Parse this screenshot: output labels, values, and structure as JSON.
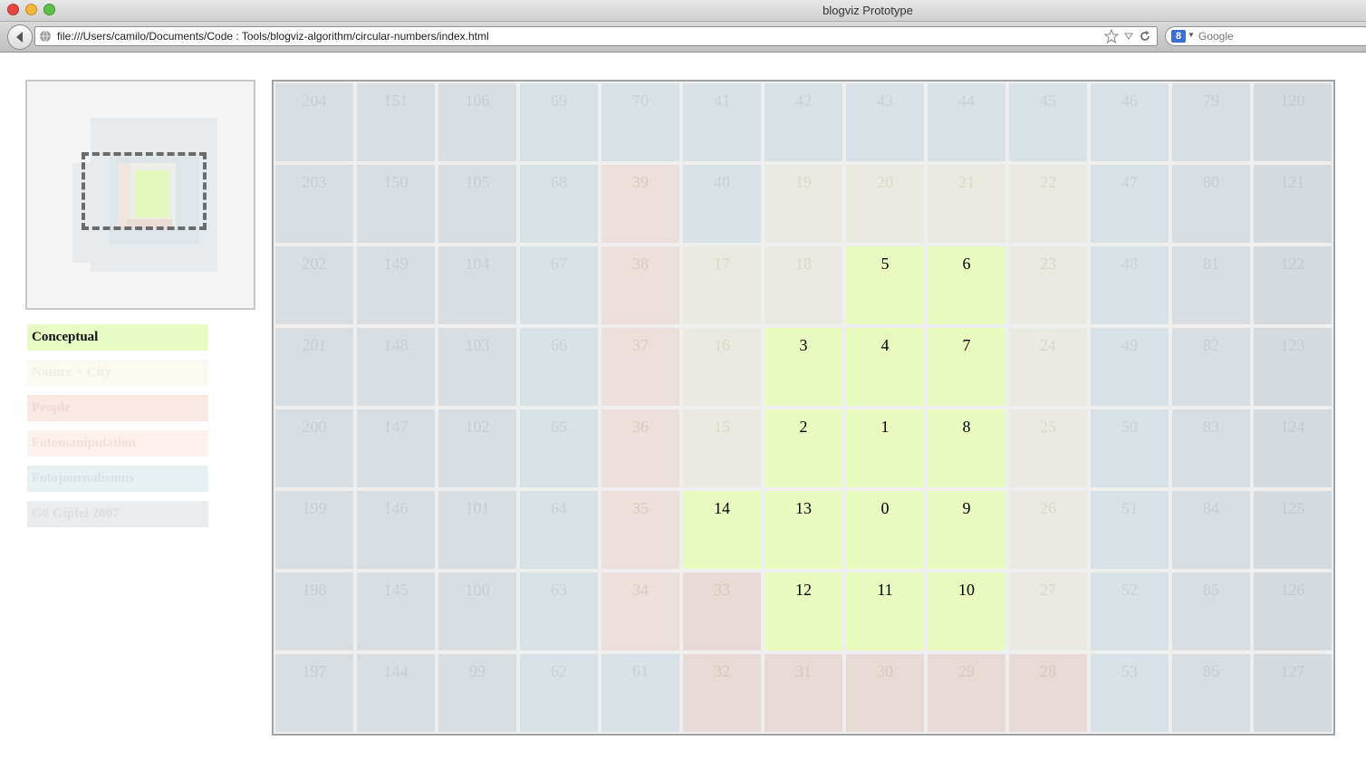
{
  "window": {
    "title": "blogviz Prototype"
  },
  "toolbar": {
    "url": "file:///Users/camilo/Documents/Code : Tools/blogviz-algorithm/circular-numbers/index.html",
    "search_placeholder": "Google"
  },
  "legend": [
    {
      "label": "Conceptual",
      "color": "#e9fbc4",
      "text_color": "#111111"
    },
    {
      "label": "Nature + City",
      "color": "#fafaf1",
      "text_color": "#efefe8"
    },
    {
      "label": "People",
      "color": "#fbe8e3",
      "text_color": "#f1dad4"
    },
    {
      "label": "Fotomanipulation",
      "color": "#fdf2ee",
      "text_color": "#f4e1da"
    },
    {
      "label": "Fotojournalismus",
      "color": "#e7f0f3",
      "text_color": "#d7e3e8"
    },
    {
      "label": "G8 Gipfel 2007",
      "color": "#e9edef",
      "text_color": "#dbe0e3"
    }
  ],
  "grid": {
    "columns": 13,
    "category_colors": {
      "A": "#d8dee1",
      "B": "#d9e2e6",
      "C": "#ebe0dc",
      "D": "#eaeae3",
      "E": "#e8fac0",
      "F": "#e8dad6",
      "G": "#d4dade"
    },
    "category_text": {
      "A": "#c7ced2",
      "B": "#c8d2d7",
      "C": "#dcc9c2",
      "D": "#d8d8cf",
      "E": "#000000",
      "F": "#dac7c1",
      "G": "#c4cbd0"
    },
    "rows": [
      {
        "numbers": [
          "204",
          "151",
          "106",
          "69",
          "70",
          "41",
          "42",
          "43",
          "44",
          "45",
          "46",
          "79",
          "120"
        ],
        "cats": [
          "A",
          "A",
          "A",
          "B",
          "B",
          "B",
          "B",
          "B",
          "B",
          "B",
          "B",
          "A",
          "G"
        ]
      },
      {
        "numbers": [
          "203",
          "150",
          "105",
          "68",
          "39",
          "40",
          "19",
          "20",
          "21",
          "22",
          "47",
          "80",
          "121"
        ],
        "cats": [
          "A",
          "A",
          "A",
          "B",
          "C",
          "B",
          "D",
          "D",
          "D",
          "D",
          "B",
          "A",
          "G"
        ]
      },
      {
        "numbers": [
          "202",
          "149",
          "104",
          "67",
          "38",
          "17",
          "18",
          "5",
          "6",
          "23",
          "48",
          "81",
          "122"
        ],
        "cats": [
          "A",
          "A",
          "A",
          "B",
          "C",
          "D",
          "D",
          "E",
          "E",
          "D",
          "B",
          "A",
          "G"
        ]
      },
      {
        "numbers": [
          "201",
          "148",
          "103",
          "66",
          "37",
          "16",
          "3",
          "4",
          "7",
          "24",
          "49",
          "82",
          "123"
        ],
        "cats": [
          "A",
          "A",
          "A",
          "B",
          "C",
          "D",
          "E",
          "E",
          "E",
          "D",
          "B",
          "A",
          "G"
        ]
      },
      {
        "numbers": [
          "200",
          "147",
          "102",
          "65",
          "36",
          "15",
          "2",
          "1",
          "8",
          "25",
          "50",
          "83",
          "124"
        ],
        "cats": [
          "A",
          "A",
          "A",
          "B",
          "C",
          "D",
          "E",
          "E",
          "E",
          "D",
          "B",
          "A",
          "G"
        ]
      },
      {
        "numbers": [
          "199",
          "146",
          "101",
          "64",
          "35",
          "14",
          "13",
          "0",
          "9",
          "26",
          "51",
          "84",
          "125"
        ],
        "cats": [
          "A",
          "A",
          "A",
          "B",
          "C",
          "E",
          "E",
          "E",
          "E",
          "D",
          "B",
          "A",
          "G"
        ]
      },
      {
        "numbers": [
          "198",
          "145",
          "100",
          "63",
          "34",
          "33",
          "12",
          "11",
          "10",
          "27",
          "52",
          "85",
          "126"
        ],
        "cats": [
          "A",
          "A",
          "A",
          "B",
          "C",
          "F",
          "E",
          "E",
          "E",
          "D",
          "B",
          "A",
          "G"
        ]
      },
      {
        "numbers": [
          "197",
          "144",
          "99",
          "62",
          "61",
          "32",
          "31",
          "30",
          "29",
          "28",
          "53",
          "86",
          "127"
        ],
        "cats": [
          "A",
          "A",
          "A",
          "B",
          "B",
          "F",
          "F",
          "F",
          "F",
          "F",
          "B",
          "A",
          "G"
        ]
      }
    ]
  }
}
